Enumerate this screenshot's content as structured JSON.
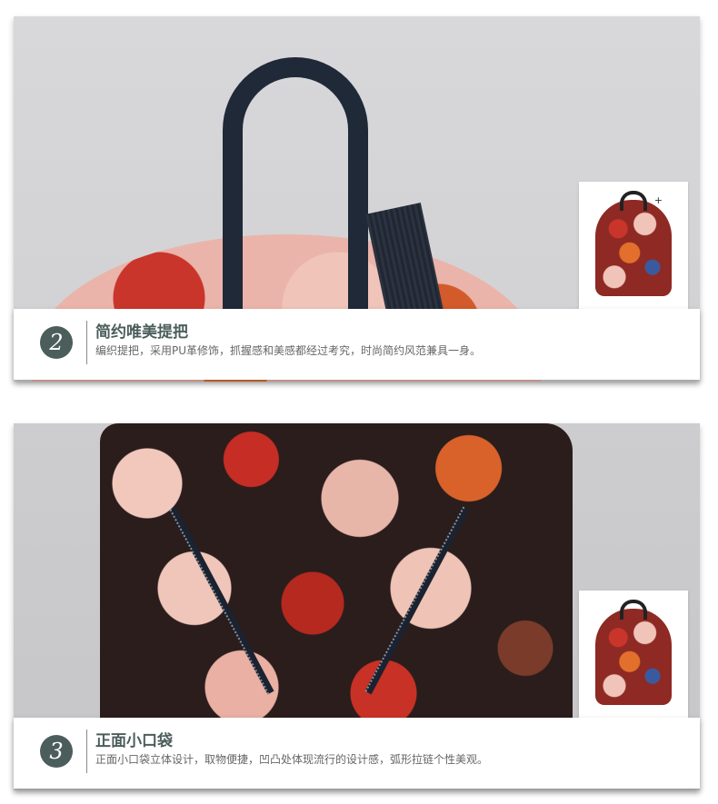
{
  "sections": [
    {
      "number": "2",
      "title": "简约唯美提把",
      "description": "编织提把，采用PU革修饰，抓握感和美感都经过考究，时尚简约风范兼具一身。"
    },
    {
      "number": "3",
      "title": "正面小口袋",
      "description": "正面小口袋立体设计，取物便捷，凹凸处体现流行的设计感，弧形拉链个性美观。"
    }
  ],
  "thumbnail_tag": "+",
  "colors": {
    "accent": "#4b5e5c",
    "description_text": "#666666"
  }
}
